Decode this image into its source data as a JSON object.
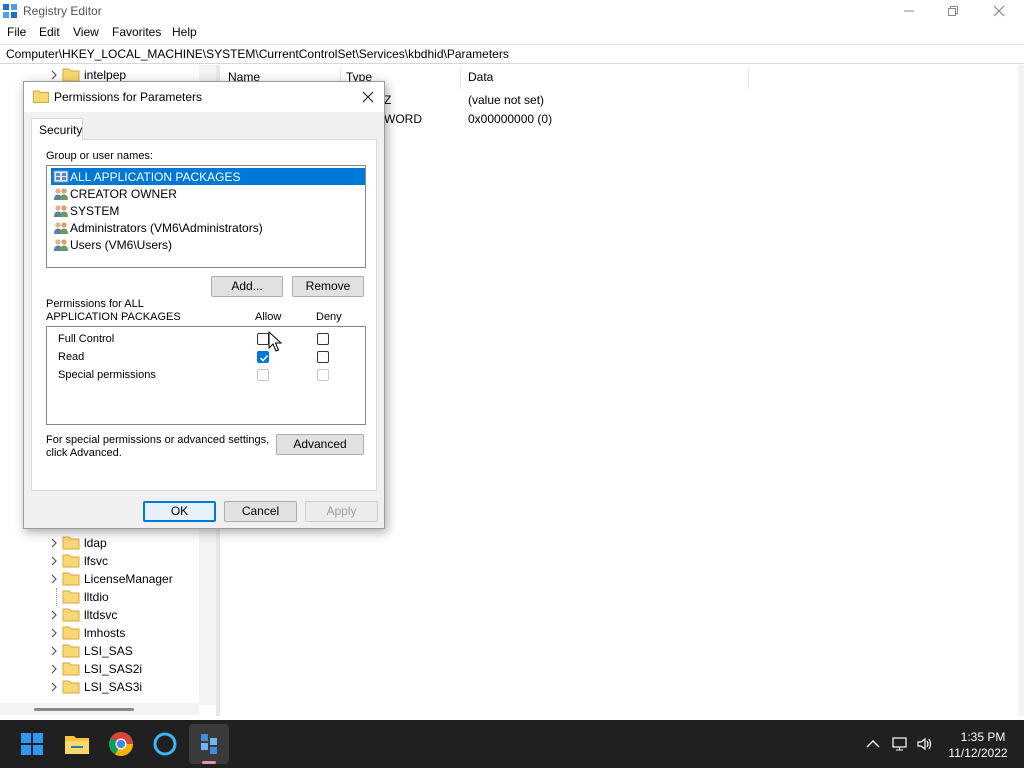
{
  "window": {
    "title": "Registry Editor"
  },
  "menu": [
    "File",
    "Edit",
    "View",
    "Favorites",
    "Help"
  ],
  "address": "Computer\\HKEY_LOCAL_MACHINE\\SYSTEM\\CurrentControlSet\\Services\\kbdhid\\Parameters",
  "tree": {
    "top_items": [
      {
        "label": "intelpep"
      }
    ],
    "bottom_items": [
      {
        "label": "ldap",
        "expandable": true
      },
      {
        "label": "lfsvc",
        "expandable": true
      },
      {
        "label": "LicenseManager",
        "expandable": true
      },
      {
        "label": "lltdio",
        "expandable": false
      },
      {
        "label": "lltdsvc",
        "expandable": true
      },
      {
        "label": "lmhosts",
        "expandable": true
      },
      {
        "label": "LSI_SAS",
        "expandable": true
      },
      {
        "label": "LSI_SAS2i",
        "expandable": true
      },
      {
        "label": "LSI_SAS3i",
        "expandable": true
      }
    ]
  },
  "values_pane": {
    "columns": [
      "Name",
      "Type",
      "Data"
    ],
    "rows": [
      {
        "type_partial": "Z",
        "data": "(value not set)"
      },
      {
        "type_partial": "WORD",
        "data": "0x00000000 (0)"
      }
    ]
  },
  "dialog": {
    "title": "Permissions for Parameters",
    "tab": "Security",
    "group_label": "Group or user names:",
    "users": [
      {
        "name": "ALL APPLICATION PACKAGES",
        "selected": true
      },
      {
        "name": "CREATOR OWNER",
        "selected": false
      },
      {
        "name": "SYSTEM",
        "selected": false
      },
      {
        "name": "Administrators (VM6\\Administrators)",
        "selected": false
      },
      {
        "name": "Users (VM6\\Users)",
        "selected": false
      }
    ],
    "add_button": "Add...",
    "remove_button": "Remove",
    "perm_label_line1": "Permissions for ALL",
    "perm_label_line2": "APPLICATION PACKAGES",
    "allow_header": "Allow",
    "deny_header": "Deny",
    "permissions": [
      {
        "name": "Full Control",
        "allow": false,
        "deny": false,
        "disabled": false
      },
      {
        "name": "Read",
        "allow": true,
        "deny": false,
        "disabled": false
      },
      {
        "name": "Special permissions",
        "allow": false,
        "deny": false,
        "disabled": true
      }
    ],
    "advanced_text_line1": "For special permissions or advanced settings,",
    "advanced_text_line2": "click Advanced.",
    "advanced_button": "Advanced",
    "ok_button": "OK",
    "cancel_button": "Cancel",
    "apply_button": "Apply"
  },
  "taskbar": {
    "icons": [
      "start-icon",
      "file-explorer-icon",
      "chrome-icon",
      "cortana-icon",
      "registry-editor-icon"
    ],
    "clock_time": "1:35 PM",
    "clock_date": "11/12/2022"
  },
  "colors": {
    "selection": "#0078d7",
    "taskbar": "#202020",
    "folder": "#f8d775"
  }
}
